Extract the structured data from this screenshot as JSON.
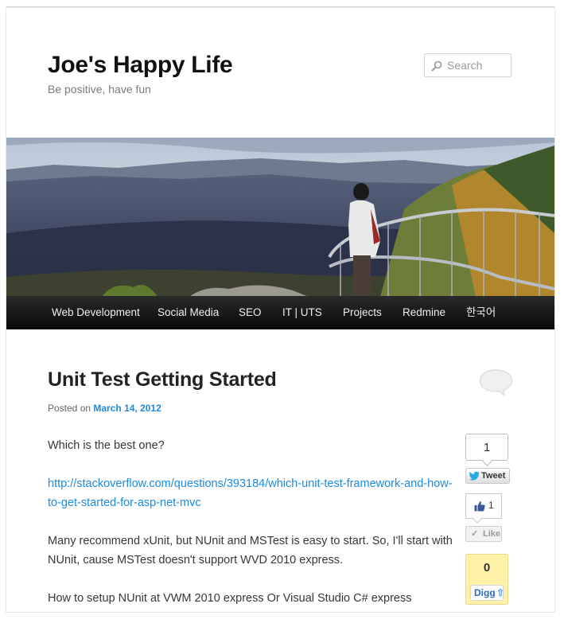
{
  "site": {
    "title": "Joe's Happy Life",
    "description": "Be positive, have fun"
  },
  "search": {
    "placeholder": "Search",
    "icon": "search-icon"
  },
  "nav": {
    "items": [
      "Web Development",
      "Social Media",
      "SEO",
      "IT | UTS",
      "Projects",
      "Redmine",
      "한국어"
    ]
  },
  "post": {
    "title": "Unit Test Getting Started",
    "posted_prefix": "Posted on",
    "date": "March 14, 2012",
    "paragraphs": [
      "Which is the best one?",
      "http://stackoverflow.com/questions/393184/which-unit-test-framework-and-how-to-get-started-for-asp-net-mvc",
      "Many recommend xUnit, but NUnit and MSTest is easy to start. So, I'll start with NUnit, cause MSTest doesn't support WVD 2010 express.",
      "How to setup NUnit at VWM 2010 express Or Visual Studio C# express"
    ]
  },
  "share": {
    "tweet_count": "1",
    "tweet_label": "Tweet",
    "fb_count": "1",
    "like_label": "Like",
    "digg_count": "0",
    "digg_label": "Digg"
  },
  "colors": {
    "link": "#1b8be0",
    "nav_bg": "#111111",
    "digg_bg": "#fff2a6"
  }
}
